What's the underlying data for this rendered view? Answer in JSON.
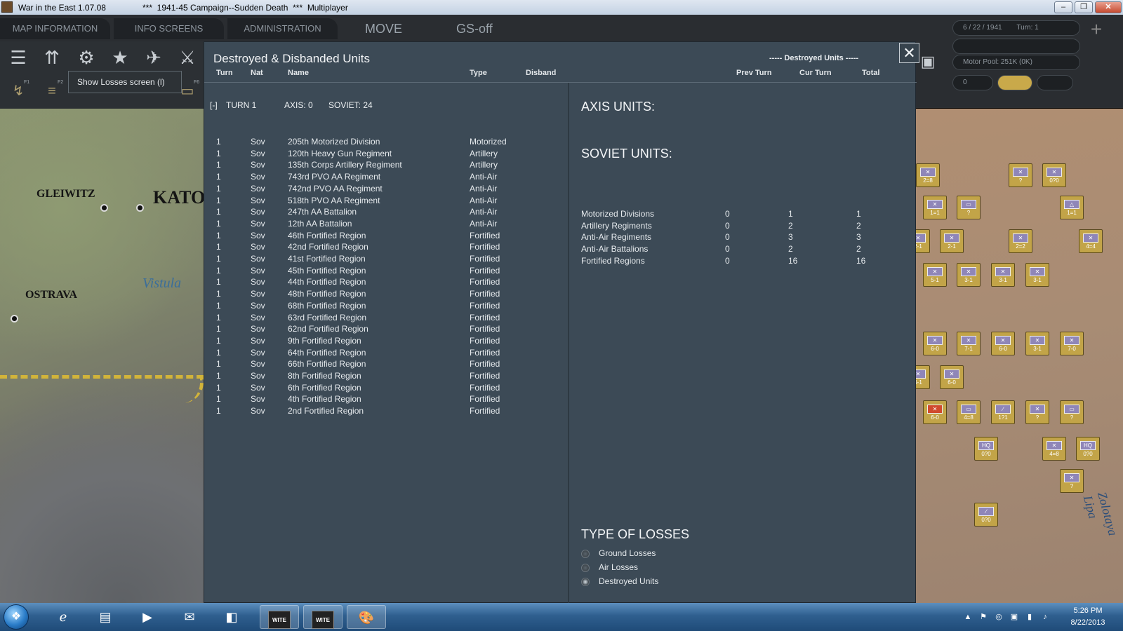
{
  "window": {
    "title": "War in the East 1.07.08",
    "subtitle": "***  1941-45 Campaign--Sudden Death  ***  Multiplayer"
  },
  "topbar": {
    "menus": [
      "MAP INFORMATION",
      "INFO SCREENS",
      "ADMINISTRATION"
    ],
    "mode": "MOVE",
    "gs": "GS-off"
  },
  "toolbar": {
    "fkeys": [
      "F1",
      "F2",
      "F6"
    ],
    "tooltip": "Show Losses screen (l)"
  },
  "status": {
    "date": "6 / 22 / 1941",
    "turn": "Turn: 1",
    "motor_pool": "Motor Pool:  251K (0K)",
    "field": "0"
  },
  "map": {
    "cities": [
      "GLEIWITZ",
      "KATO",
      "OSTRAVA"
    ],
    "river": "Vistula",
    "river2": "Zolotaya Lipa",
    "units": [
      {
        "str": "2=8"
      },
      {
        "str": "?"
      },
      {
        "str": "0?0"
      },
      {
        "str": "1=1"
      },
      {
        "str": "?"
      },
      {
        "str": "1=1"
      },
      {
        "str": "2-1"
      },
      {
        "str": "2-1"
      },
      {
        "str": "2=2"
      },
      {
        "str": "4=4"
      },
      {
        "str": "5-1"
      },
      {
        "str": "3-1"
      },
      {
        "str": "3-1"
      },
      {
        "str": "3-1"
      },
      {
        "str": "6-0"
      },
      {
        "str": "7-1"
      },
      {
        "str": "6-0"
      },
      {
        "str": "3-1"
      },
      {
        "str": "7-0"
      },
      {
        "str": "6-1"
      },
      {
        "str": "6-0"
      },
      {
        "str": "6-0"
      },
      {
        "str": "4=8"
      },
      {
        "str": "1?1"
      },
      {
        "str": "?"
      },
      {
        "str": "?"
      },
      {
        "str": "0?0"
      },
      {
        "str": "4=8"
      },
      {
        "str": "0?0"
      },
      {
        "str": "?"
      },
      {
        "str": "0?0"
      }
    ]
  },
  "dialog": {
    "title": "Destroyed & Disbanded Units",
    "mode_label": "----- Destroyed Units -----",
    "close": "✕",
    "columns": {
      "turn": "Turn",
      "nat": "Nat",
      "name": "Name",
      "type": "Type",
      "disband": "Disband",
      "prev": "Prev Turn",
      "cur": "Cur Turn",
      "total": "Total"
    },
    "turn_group": {
      "toggle": "[-]",
      "label": "TURN 1",
      "axis": "AXIS: 0",
      "soviet": "SOVIET: 24"
    },
    "units": [
      {
        "turn": "1",
        "nat": "Sov",
        "name": "205th Motorized Division",
        "type": "Motorized"
      },
      {
        "turn": "1",
        "nat": "Sov",
        "name": "120th Heavy Gun Regiment",
        "type": "Artillery"
      },
      {
        "turn": "1",
        "nat": "Sov",
        "name": "135th Corps Artillery Regiment",
        "type": "Artillery"
      },
      {
        "turn": "1",
        "nat": "Sov",
        "name": "743rd PVO AA Regiment",
        "type": "Anti-Air"
      },
      {
        "turn": "1",
        "nat": "Sov",
        "name": "742nd PVO AA Regiment",
        "type": "Anti-Air"
      },
      {
        "turn": "1",
        "nat": "Sov",
        "name": "518th PVO AA Regiment",
        "type": "Anti-Air"
      },
      {
        "turn": "1",
        "nat": "Sov",
        "name": "247th AA Battalion",
        "type": "Anti-Air"
      },
      {
        "turn": "1",
        "nat": "Sov",
        "name": "12th AA Battalion",
        "type": "Anti-Air"
      },
      {
        "turn": "1",
        "nat": "Sov",
        "name": "46th Fortified Region",
        "type": "Fortified"
      },
      {
        "turn": "1",
        "nat": "Sov",
        "name": "42nd Fortified Region",
        "type": "Fortified"
      },
      {
        "turn": "1",
        "nat": "Sov",
        "name": "41st Fortified Region",
        "type": "Fortified"
      },
      {
        "turn": "1",
        "nat": "Sov",
        "name": "45th Fortified Region",
        "type": "Fortified"
      },
      {
        "turn": "1",
        "nat": "Sov",
        "name": "44th Fortified Region",
        "type": "Fortified"
      },
      {
        "turn": "1",
        "nat": "Sov",
        "name": "48th Fortified Region",
        "type": "Fortified"
      },
      {
        "turn": "1",
        "nat": "Sov",
        "name": "68th Fortified Region",
        "type": "Fortified"
      },
      {
        "turn": "1",
        "nat": "Sov",
        "name": "63rd Fortified Region",
        "type": "Fortified"
      },
      {
        "turn": "1",
        "nat": "Sov",
        "name": "62nd Fortified Region",
        "type": "Fortified"
      },
      {
        "turn": "1",
        "nat": "Sov",
        "name": "9th Fortified Region",
        "type": "Fortified"
      },
      {
        "turn": "1",
        "nat": "Sov",
        "name": "64th Fortified Region",
        "type": "Fortified"
      },
      {
        "turn": "1",
        "nat": "Sov",
        "name": "66th Fortified Region",
        "type": "Fortified"
      },
      {
        "turn": "1",
        "nat": "Sov",
        "name": "8th Fortified Region",
        "type": "Fortified"
      },
      {
        "turn": "1",
        "nat": "Sov",
        "name": "6th Fortified Region",
        "type": "Fortified"
      },
      {
        "turn": "1",
        "nat": "Sov",
        "name": "4th Fortified Region",
        "type": "Fortified"
      },
      {
        "turn": "1",
        "nat": "Sov",
        "name": "2nd Fortified Region",
        "type": "Fortified"
      }
    ],
    "axis_heading": "AXIS UNITS:",
    "soviet_heading": "SOVIET UNITS:",
    "soviet_summary": [
      {
        "name": "Motorized Divisions",
        "prev": "0",
        "cur": "1",
        "total": "1"
      },
      {
        "name": "Artillery Regiments",
        "prev": "0",
        "cur": "2",
        "total": "2"
      },
      {
        "name": "Anti-Air Regiments",
        "prev": "0",
        "cur": "3",
        "total": "3"
      },
      {
        "name": "Anti-Air Battalions",
        "prev": "0",
        "cur": "2",
        "total": "2"
      },
      {
        "name": "Fortified Regions",
        "prev": "0",
        "cur": "16",
        "total": "16"
      }
    ],
    "loss_types_heading": "TYPE OF LOSSES",
    "loss_types": [
      {
        "label": "Ground Losses",
        "selected": false
      },
      {
        "label": "Air Losses",
        "selected": false
      },
      {
        "label": "Destroyed Units",
        "selected": true
      }
    ]
  },
  "taskbar": {
    "apps": [
      "ie-icon",
      "explorer-icon",
      "media-player-icon",
      "outlook-icon",
      "office-icon",
      "wite-icon",
      "wite-icon",
      "paint-icon"
    ],
    "wite_logo": "WITE",
    "time": "5:26 PM",
    "date": "8/22/2013"
  },
  "colors": {
    "dialog_bg": "#3c4a56",
    "topbar_bg": "#2a2d31",
    "axis_counter": "#c2a448",
    "soviet_counter": "#d04a2e"
  }
}
